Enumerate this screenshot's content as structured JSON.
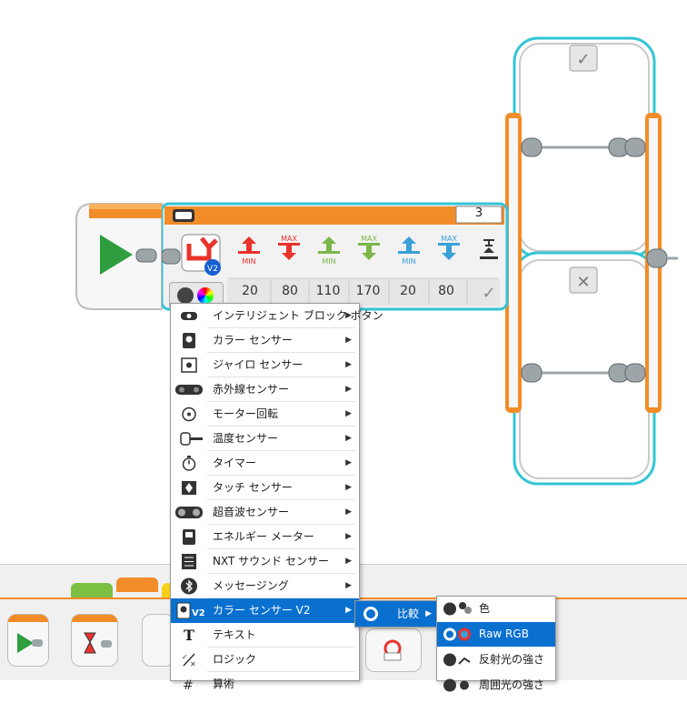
{
  "switch": {
    "case_count": "3",
    "values": [
      "20",
      "80",
      "110",
      "170",
      "20",
      "80"
    ],
    "port_labels": [
      "MIN",
      "MAX",
      "MIN",
      "MAX",
      "MIN",
      "MAX"
    ],
    "colors": {
      "red": "#e8332b",
      "green": "#7ab648",
      "blue": "#3aa0d8",
      "accent": "#f28c28",
      "case_border": "#33c5d6"
    }
  },
  "menu_main": {
    "items": [
      {
        "label": "インテリジェント ブロック ボタン",
        "icon": "brick-buttons-icon"
      },
      {
        "label": "カラー センサー",
        "icon": "color-sensor-icon"
      },
      {
        "label": "ジャイロ センサー",
        "icon": "gyro-sensor-icon"
      },
      {
        "label": "赤外線センサー",
        "icon": "infrared-sensor-icon"
      },
      {
        "label": "モーター回転",
        "icon": "motor-rotation-icon"
      },
      {
        "label": "温度センサー",
        "icon": "temperature-sensor-icon"
      },
      {
        "label": "タイマー",
        "icon": "timer-icon"
      },
      {
        "label": "タッチ センサー",
        "icon": "touch-sensor-icon"
      },
      {
        "label": "超音波センサー",
        "icon": "ultrasonic-sensor-icon"
      },
      {
        "label": "エネルギー メーター",
        "icon": "energy-meter-icon"
      },
      {
        "label": "NXT サウンド センサー",
        "icon": "nxt-sound-sensor-icon"
      },
      {
        "label": "メッセージング",
        "icon": "bluetooth-icon"
      },
      {
        "label": "カラー センサー V2",
        "icon": "color-sensor-v2-icon",
        "badge": "V2"
      },
      {
        "label": "テキスト",
        "icon": "text-icon",
        "glyph": "T"
      },
      {
        "label": "ロジック",
        "icon": "logic-icon"
      },
      {
        "label": "算術",
        "icon": "math-icon"
      }
    ]
  },
  "menu_sub": {
    "label": "比較"
  },
  "menu_sub2": {
    "items": [
      {
        "label": "色"
      },
      {
        "label": "Raw RGB"
      },
      {
        "label": "反射光の強さ"
      },
      {
        "label": "周囲光の強さ"
      }
    ]
  }
}
